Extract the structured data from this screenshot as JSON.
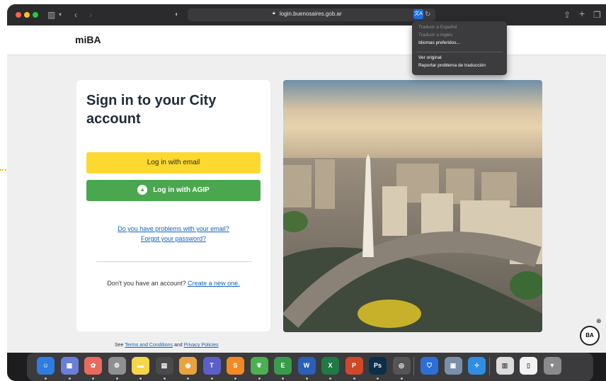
{
  "browser": {
    "url": "login.buenosaires.gob.ar",
    "translate_menu": [
      {
        "label": "Traducir a Español",
        "enabled": false
      },
      {
        "label": "Traducir a Inglés",
        "enabled": false
      },
      {
        "label": "Idiomas preferidos...",
        "enabled": true
      },
      {
        "label": "Ver original",
        "enabled": true
      },
      {
        "label": "Reportar problema de traducción",
        "enabled": true
      }
    ]
  },
  "header": {
    "logo": "miBA"
  },
  "login": {
    "title": "Sign in to your City account",
    "email_button": "Log in with email",
    "agip_button": "Log in with AGIP",
    "problems_link": "Do you have problems with your email?",
    "forgot_link": "Forgot your password?",
    "no_account_text": "Don't you have an account?",
    "create_link": "Create a new one."
  },
  "footer": {
    "see": "See",
    "terms_link": "Terms and Conditions",
    "and": "and",
    "privacy_link": "Privacy Policies"
  },
  "badge": {
    "label": "BA"
  },
  "colors": {
    "email_button": "#fdd82f",
    "agip_button": "#4aa74f",
    "link": "#1463b8",
    "annotation": "#f2b705"
  },
  "dock": {
    "apps": [
      {
        "name": "finder",
        "glyph": "☺",
        "color": "#2f7de1"
      },
      {
        "name": "launchpad",
        "glyph": "▦",
        "color": "#6a7fd8"
      },
      {
        "name": "photos",
        "glyph": "✿",
        "color": "#e86b5d"
      },
      {
        "name": "system-settings",
        "glyph": "⚙",
        "color": "#8e8e93"
      },
      {
        "name": "notes",
        "glyph": "▬",
        "color": "#f5d54a"
      },
      {
        "name": "calculator",
        "glyph": "▤",
        "color": "#4a4a4a"
      },
      {
        "name": "chrome",
        "glyph": "◉",
        "color": "#e8a33d"
      },
      {
        "name": "teams",
        "glyph": "T",
        "color": "#5b5fc7"
      },
      {
        "name": "sublime",
        "glyph": "S",
        "color": "#f08a24"
      },
      {
        "name": "leaf-app",
        "glyph": "❦",
        "color": "#4caf50"
      },
      {
        "name": "evernote",
        "glyph": "E",
        "color": "#3a9b4b"
      },
      {
        "name": "word",
        "glyph": "W",
        "color": "#2b5fb8"
      },
      {
        "name": "excel",
        "glyph": "X",
        "color": "#1f7a45"
      },
      {
        "name": "powerpoint",
        "glyph": "P",
        "color": "#d0482a"
      },
      {
        "name": "photoshop",
        "glyph": "Ps",
        "color": "#0b2f4a"
      },
      {
        "name": "screenshot",
        "glyph": "◎",
        "color": "#555555"
      },
      {
        "name": "vpn-shield",
        "glyph": "⛉",
        "color": "#2d6fd6"
      },
      {
        "name": "preview",
        "glyph": "▣",
        "color": "#7a8fa8"
      },
      {
        "name": "safari",
        "glyph": "✧",
        "color": "#2f8de4"
      },
      {
        "name": "documents",
        "glyph": "▥",
        "color": "#dcdcdc"
      },
      {
        "name": "file",
        "glyph": "▯",
        "color": "#f2f2f2"
      },
      {
        "name": "trash",
        "glyph": "▼",
        "color": "#8a8a8d"
      }
    ]
  }
}
